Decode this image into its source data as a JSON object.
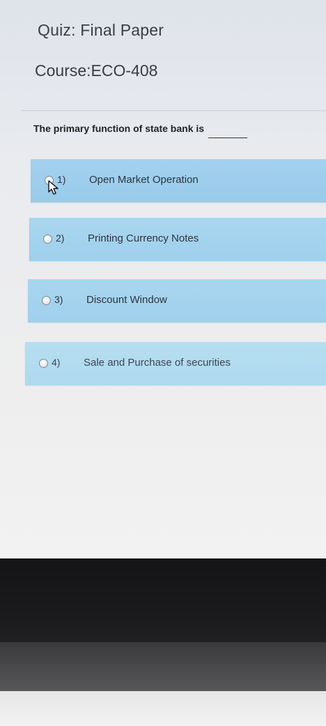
{
  "page": {
    "quiz_title": "Quiz: Final Paper",
    "course_title": "Course:ECO-408"
  },
  "question": {
    "text": "The primary function of state bank is"
  },
  "options": [
    {
      "number": "1)",
      "label": "Open Market Operation"
    },
    {
      "number": "2)",
      "label": "Printing Currency Notes"
    },
    {
      "number": "3)",
      "label": "Discount Window"
    },
    {
      "number": "4)",
      "label": "Sale and Purchase of securities"
    }
  ],
  "colors": {
    "option_background": "#a3d1ee",
    "text": "#2c3440",
    "page_background": "#eeeeee"
  }
}
